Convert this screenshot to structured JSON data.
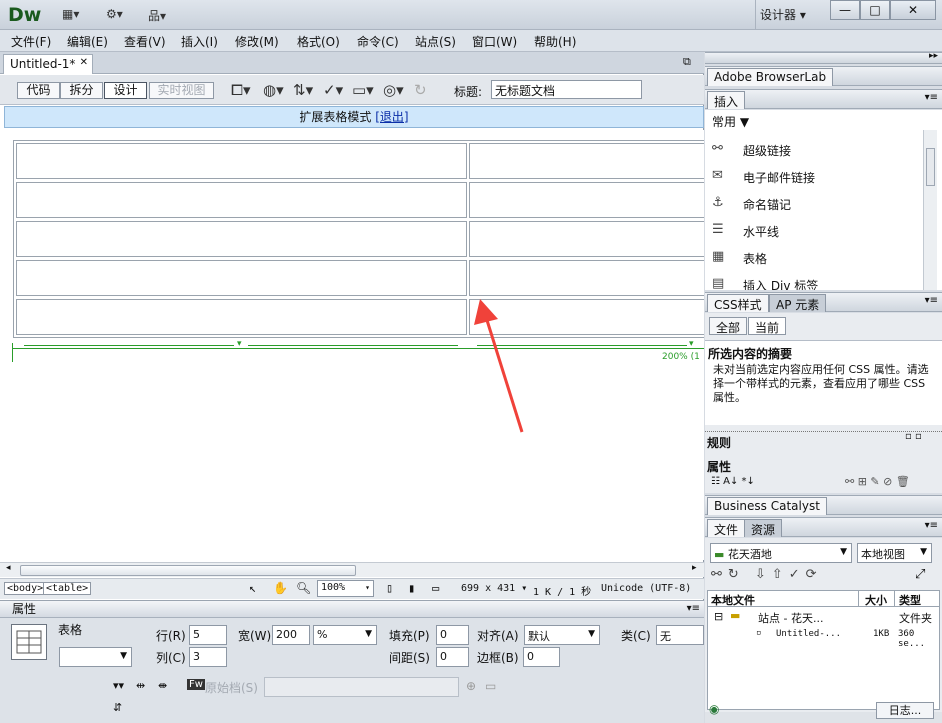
{
  "app": {
    "logo": "Dw",
    "workspace_label": "设计器",
    "win_minimize": "—",
    "win_maximize": "□",
    "win_close": "✕"
  },
  "menu": [
    "文件(F)",
    "编辑(E)",
    "查看(V)",
    "插入(I)",
    "修改(M)",
    "格式(O)",
    "命令(C)",
    "站点(S)",
    "窗口(W)",
    "帮助(H)"
  ],
  "document": {
    "tab_name": "Untitled-1*",
    "tab_close": "✕",
    "view_buttons": [
      "代码",
      "拆分",
      "设计",
      "实时视图"
    ],
    "title_label": "标题:",
    "title_value": "无标题文档",
    "expanded_mode_text": "扩展表格模式",
    "expanded_exit": "[退出]",
    "table_width_label": "200% (1"
  },
  "table": {
    "rows": 5,
    "cols": 2
  },
  "statusbar": {
    "tags": [
      "<body>",
      "<table>"
    ],
    "zoom": "100%",
    "dimensions": "699 x 431",
    "size": "1 K / 1 秒",
    "encoding": "Unicode (UTF-8)"
  },
  "properties": {
    "header": "属性",
    "element_label": "表格",
    "rows_label": "行(R)",
    "rows_value": "5",
    "cols_label": "列(C)",
    "cols_value": "3",
    "width_label": "宽(W)",
    "width_value": "200",
    "width_unit": "%",
    "padding_label": "填充(P)",
    "padding_value": "0",
    "spacing_label": "间距(S)",
    "spacing_value": "0",
    "align_label": "对齐(A)",
    "align_value": "默认",
    "border_label": "边框(B)",
    "border_value": "0",
    "class_label": "类(C)",
    "class_value": "无",
    "source_label": "原始档(S)"
  },
  "panels": {
    "browserlab_title": "Adobe BrowserLab",
    "insert_tab": "插入",
    "insert_category": "常用",
    "insert_items": [
      "超级链接",
      "电子邮件链接",
      "命名锚记",
      "水平线",
      "表格",
      "插入 Div 标签"
    ],
    "css_tab": "CSS样式",
    "ap_tab": "AP 元素",
    "css_all": "全部",
    "css_current": "当前",
    "summary_title": "所选内容的摘要",
    "summary_text": "未对当前选定内容应用任何 CSS 属性。请选择一个带样式的元素，查看应用了哪些 CSS 属性。",
    "rules_label": "规则",
    "props_label": "属性",
    "bc_title": "Business Catalyst",
    "files_tab": "文件",
    "assets_tab": "资源",
    "site_select": "花天酒地",
    "view_select": "本地视图",
    "col_local": "本地文件",
    "col_size": "大小",
    "col_type": "类型",
    "site_row": "站点 - 花天...",
    "site_type": "文件夹",
    "file_row": "Untitled-...",
    "file_size": "1KB",
    "file_type": "360 se...",
    "log_button": "日志..."
  }
}
